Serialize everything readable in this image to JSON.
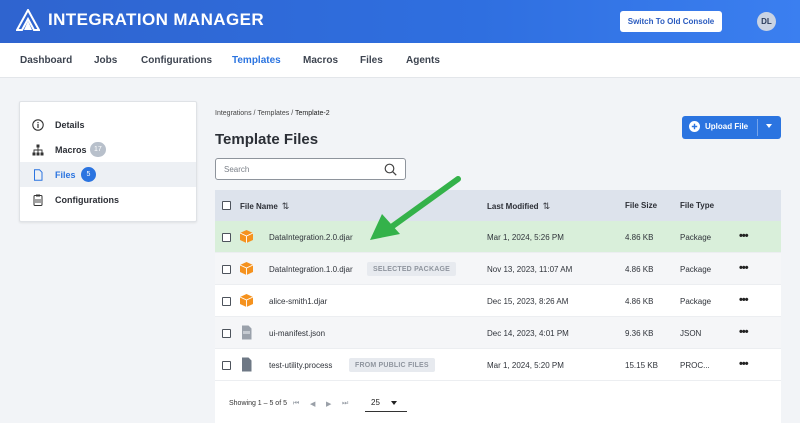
{
  "header": {
    "app_title": "INTEGRATION MANAGER",
    "switch_label": "Switch To Old Console",
    "avatar_initials": "DL",
    "brand_color": "#2f6fe0"
  },
  "nav": {
    "items": [
      "Dashboard",
      "Jobs",
      "Configurations",
      "Templates",
      "Macros",
      "Files",
      "Agents"
    ],
    "active": "Templates"
  },
  "sidebar": {
    "items": [
      {
        "label": "Details",
        "icon": "info-icon",
        "badge": ""
      },
      {
        "label": "Macros",
        "icon": "hierarchy-icon",
        "badge": "17"
      },
      {
        "label": "Files",
        "icon": "file-icon",
        "badge": "5"
      },
      {
        "label": "Configurations",
        "icon": "clipboard-icon",
        "badge": ""
      }
    ],
    "active": "Files"
  },
  "breadcrumb": {
    "part1": "Integrations",
    "part2": "Templates",
    "current": "Template-2",
    "sep": "/"
  },
  "page_title": "Template Files",
  "upload_label": "Upload File",
  "search": {
    "placeholder": "Search"
  },
  "table": {
    "headers": {
      "name": "File Name",
      "modified": "Last Modified",
      "size": "File Size",
      "type": "File Type"
    },
    "sort_icon": "⇅",
    "rows": [
      {
        "name": "DataIntegration.2.0.djar",
        "tag": "",
        "modified": "Mar 1, 2024, 5:26 PM",
        "size": "4.86 KB",
        "type": "Package",
        "icon": "package-icon"
      },
      {
        "name": "DataIntegration.1.0.djar",
        "tag": "SELECTED PACKAGE",
        "modified": "Nov 13, 2023, 11:07 AM",
        "size": "4.86 KB",
        "type": "Package",
        "icon": "package-icon"
      },
      {
        "name": "alice-smith1.djar",
        "tag": "",
        "modified": "Dec 15, 2023, 8:26 AM",
        "size": "4.86 KB",
        "type": "Package",
        "icon": "package-icon"
      },
      {
        "name": "ui-manifest.json",
        "tag": "",
        "modified": "Dec 14, 2023, 4:01 PM",
        "size": "9.36 KB",
        "type": "JSON",
        "icon": "json-file-icon"
      },
      {
        "name": "test-utility.process",
        "tag": "FROM PUBLIC FILES",
        "modified": "Mar 1, 2024, 5:20 PM",
        "size": "15.15 KB",
        "type": "PROC...",
        "icon": "process-file-icon"
      }
    ],
    "more_icon": "•••"
  },
  "pager": {
    "info": "Showing 1 – 5 of 5",
    "per_page": "25",
    "first": "⏮",
    "prev": "◀",
    "next": "▶",
    "last": "⏭"
  },
  "colors": {
    "accent": "#2b74e0",
    "highlight_row": "#d9efda",
    "annotation_arrow": "#34b24a",
    "package_orange": "#f5921e"
  }
}
